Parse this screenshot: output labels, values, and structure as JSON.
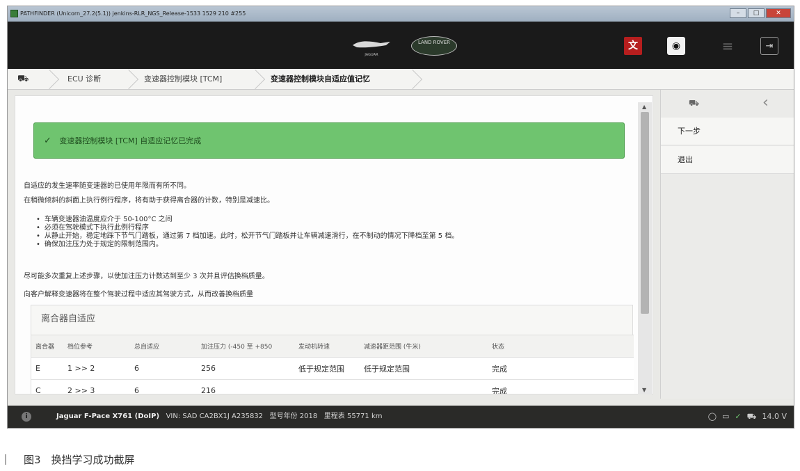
{
  "window": {
    "title": "PATHFINDER (Unicorn_27.2(5.1)) jenkins-RLR_NGS_Release-1533 1529 210 #255",
    "controls": [
      "minimize",
      "maximize",
      "close"
    ]
  },
  "header": {
    "brand_jaguar": "JAGUAR",
    "brand_landrover": "LAND ROVER",
    "icons": [
      "language-icon",
      "camera-icon",
      "menu-icon",
      "exit-icon"
    ]
  },
  "breadcrumb": {
    "items": [
      "ECU 诊断",
      "变速器控制模块 [TCM]",
      "变速器控制模块自适应值记忆"
    ]
  },
  "main": {
    "success_message": "变速器控制模块 [TCM] 自适应记忆已完成",
    "p1": "自适应的发生速率随变速器的已使用年限而有所不同。",
    "p2": "在稍微倾斜的斜面上执行例行程序，将有助于获得离合器的计数，特别是减速比。",
    "bullets": [
      "车辆变速器油温度应介于 50-100°C 之间",
      "必须在驾驶模式下执行此例行程序",
      "从静止开始，稳定地踩下节气门踏板，通过第 7 档加速。此时，松开节气门踏板并让车辆减速滑行，在不制动的情况下降档至第 5 档。",
      "确保加注压力处于规定的限制范围内。"
    ],
    "p3": "尽可能多次重复上述步骤，以使加注压力计数达到至少 3 次并且评估换档质量。",
    "p4": "向客户解释变速器将在整个驾驶过程中适应其驾驶方式，从而改善换档质量",
    "table": {
      "title": "离合器自适应",
      "columns": [
        "离合器",
        "档位参考",
        "总自适应",
        "加注压力 (-450 至 +850",
        "发动机转速",
        "减速器距范围 (牛米)",
        "状态"
      ],
      "rows": [
        [
          "E",
          "1 >> 2",
          "6",
          "256",
          "低于规定范围",
          "低于规定范围",
          "完成"
        ],
        [
          "C",
          "2 >> 3",
          "6",
          "216",
          "",
          "",
          "完成"
        ]
      ]
    }
  },
  "right_panel": {
    "next_label": "下一步",
    "exit_label": "退出"
  },
  "statusbar": {
    "vehicle": "Jaguar F-Pace X761 (DoIP)",
    "vin": "VIN: SAD CA2BX1J A235832",
    "model_year": "型号年份 2018",
    "mileage": "里程表 55771 km",
    "voltage": "14.0 V"
  },
  "caption": "图3　换挡学习成功截屏"
}
